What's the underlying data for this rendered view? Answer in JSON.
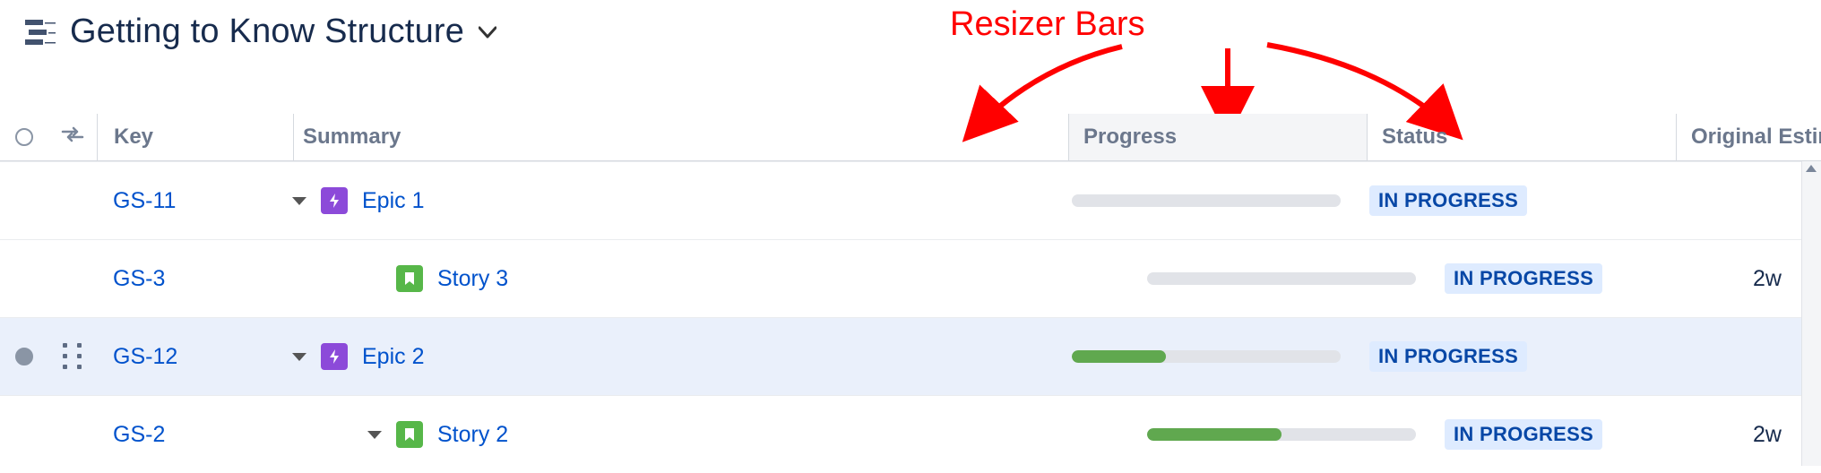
{
  "annotation": {
    "label": "Resizer Bars"
  },
  "title": {
    "text": "Getting to Know Structure"
  },
  "columns": {
    "key": "Key",
    "summary": "Summary",
    "progress": "Progress",
    "status": "Status",
    "original_estimate": "Original Estimate"
  },
  "rows": [
    {
      "key": "GS-11",
      "summary": "Epic 1",
      "type": "epic",
      "indent": 0,
      "expandable": true,
      "progress_pct": 0,
      "status": "IN PROGRESS",
      "estimate": "",
      "selected": false
    },
    {
      "key": "GS-3",
      "summary": "Story 3",
      "type": "story",
      "indent": 1,
      "expandable": false,
      "progress_pct": 0,
      "status": "IN PROGRESS",
      "estimate": "2w",
      "selected": false
    },
    {
      "key": "GS-12",
      "summary": "Epic 2",
      "type": "epic",
      "indent": 0,
      "expandable": true,
      "progress_pct": 35,
      "status": "IN PROGRESS",
      "estimate": "",
      "selected": true
    },
    {
      "key": "GS-2",
      "summary": "Story 2",
      "type": "story",
      "indent": 1,
      "expandable": true,
      "progress_pct": 50,
      "status": "IN PROGRESS",
      "estimate": "2w",
      "selected": false
    }
  ]
}
